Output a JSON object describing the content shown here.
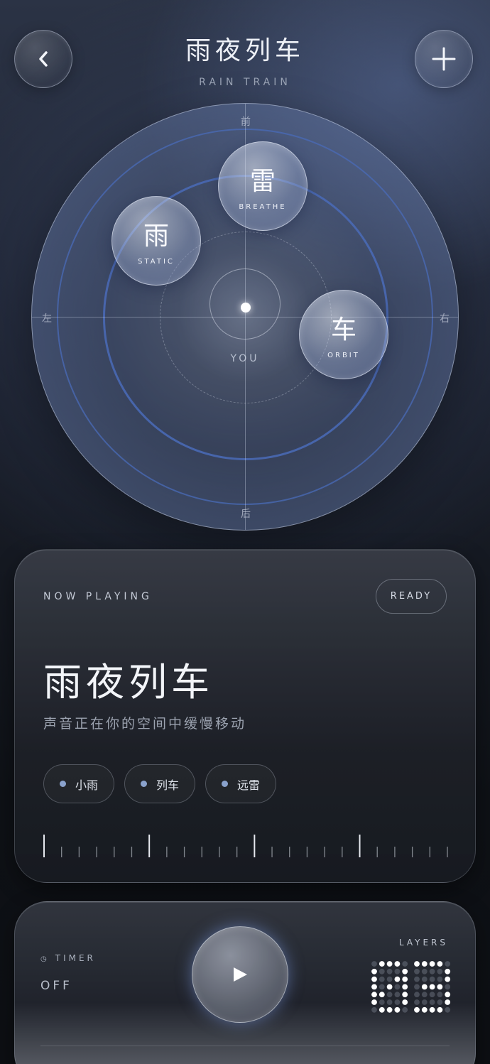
{
  "header": {
    "back_icon": "chevron-left-icon",
    "title": "雨夜列车",
    "subtitle": "RAIN TRAIN",
    "add_icon": "plus-icon"
  },
  "spatial": {
    "directions": {
      "front": "前",
      "back": "后",
      "left": "左",
      "right": "右"
    },
    "listener_label": "YOU",
    "sources": [
      {
        "char": "雷",
        "mode": "BREATHE"
      },
      {
        "char": "雨",
        "mode": "STATIC"
      },
      {
        "char": "车",
        "mode": "ORBIT"
      }
    ]
  },
  "now_playing": {
    "label": "NOW PLAYING",
    "status": "READY",
    "title": "雨夜列车",
    "description": "声音正在你的空间中缓慢移动",
    "layers": [
      {
        "label": "小雨"
      },
      {
        "label": "列车"
      },
      {
        "label": "远雷"
      }
    ]
  },
  "controls": {
    "timer_icon": "clock-icon",
    "timer_label": "TIMER",
    "timer_value": "OFF",
    "play_icon": "play-icon",
    "layers_label": "LAYERS",
    "layers_count": "03"
  },
  "colors": {
    "accent": "#4a6bb8",
    "chip_dot": "#8aa2cc"
  }
}
